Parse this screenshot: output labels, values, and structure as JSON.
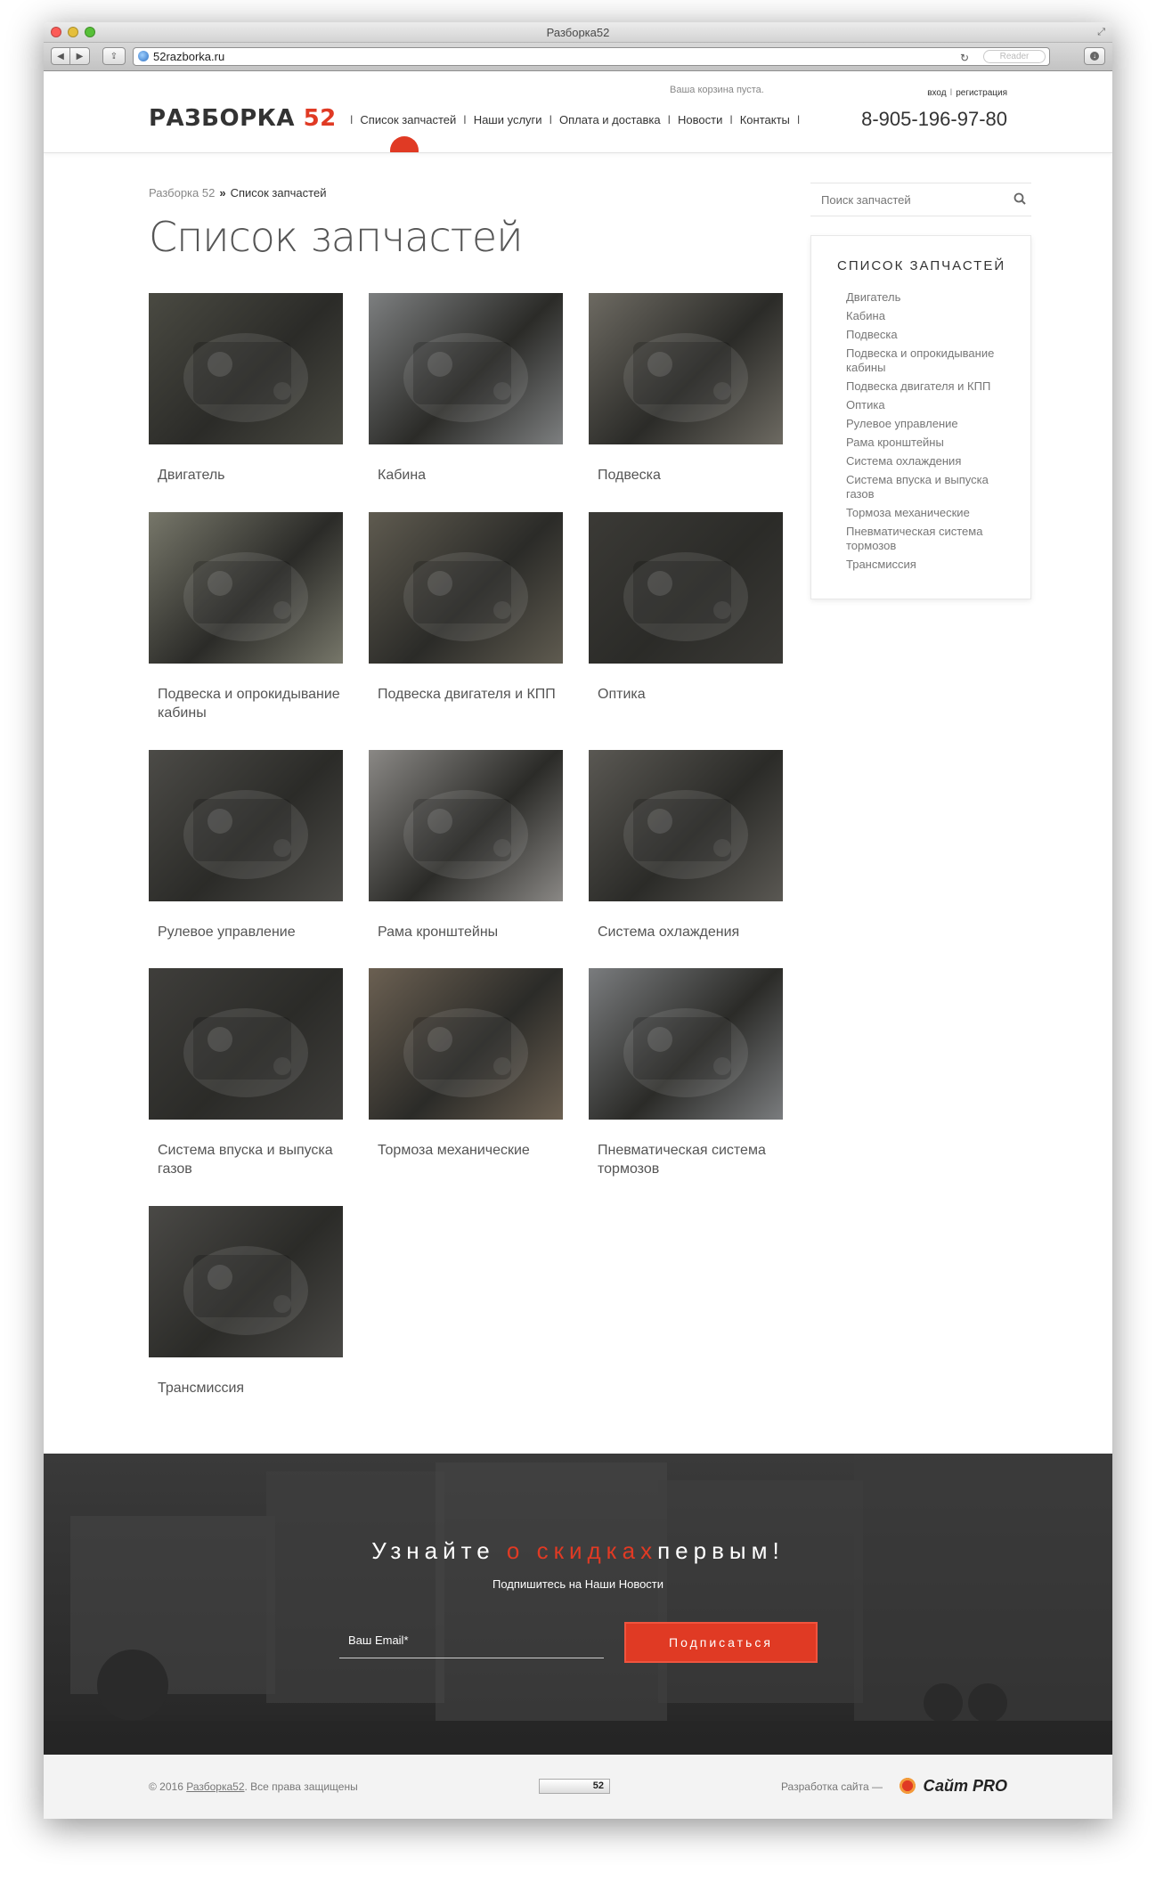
{
  "window": {
    "title": "Разборка52",
    "url": "52razborka.ru",
    "reader_label": "Reader"
  },
  "header": {
    "logo_text": "РАЗБОРКА",
    "logo_number": "52",
    "cart_status": "Ваша корзина пуста.",
    "login": "вход",
    "register": "регистрация",
    "phone": "8-905-196-97-80",
    "nav": [
      {
        "label": "Список запчастей"
      },
      {
        "label": "Наши услуги"
      },
      {
        "label": "Оплата и доставка"
      },
      {
        "label": "Новости"
      },
      {
        "label": "Контакты"
      }
    ]
  },
  "breadcrumb": {
    "home": "Разборка 52",
    "separator": "»",
    "current": "Список запчастей"
  },
  "page_title": "Список запчастей",
  "categories": [
    {
      "label": "Двигатель",
      "img_color": "#4a4a42"
    },
    {
      "label": "Кабина",
      "img_color": "#7d7f80"
    },
    {
      "label": "Подвеска",
      "img_color": "#6d6a62"
    },
    {
      "label": "Подвеска и опрокидывание кабины",
      "img_color": "#77776a"
    },
    {
      "label": "Подвеска двигателя и КПП",
      "img_color": "#5f5b50"
    },
    {
      "label": "Оптика",
      "img_color": "#3b3a36"
    },
    {
      "label": "Рулевое управление",
      "img_color": "#4c4b47"
    },
    {
      "label": "Рама кронштейны",
      "img_color": "#8a8885"
    },
    {
      "label": "Система охлаждения",
      "img_color": "#5a5853"
    },
    {
      "label": "Система впуска и выпуска газов",
      "img_color": "#3f3e3b"
    },
    {
      "label": "Тормоза механические",
      "img_color": "#6b6052"
    },
    {
      "label": "Пневматическая система тормозов",
      "img_color": "#7a7c7e"
    },
    {
      "label": "Трансмиссия",
      "img_color": "#4a4946"
    }
  ],
  "search": {
    "placeholder": "Поиск запчастей"
  },
  "sidebar": {
    "title": "Список запчастей",
    "items": [
      "Двигатель",
      "Кабина",
      "Подвеска",
      "Подвеска и опрокидывание кабины",
      "Подвеска двигателя и КПП",
      "Оптика",
      "Рулевое управление",
      "Рама кронштейны",
      "Система охлаждения",
      "Система впуска и выпуска газов",
      "Тормоза механические",
      "Пневматическая система тормозов",
      "Трансмиссия"
    ]
  },
  "subscribe": {
    "title_pre": "Узнайте ",
    "title_highlight": "о скидках",
    "title_post": "первым!",
    "subtitle": "Подпишитесь на Наши Новости",
    "email_placeholder": "Ваш Email*",
    "button": "Подписаться"
  },
  "footer": {
    "copyright_pre": "© 2016 ",
    "copyright_link": "Разборка52",
    "copyright_post": ". Все права защищены",
    "counter": "52",
    "dev_credit": "Разработка сайта —",
    "dev_logo": "Сайт PRO"
  },
  "colors": {
    "accent": "#e03a24",
    "dark_band": "#303030",
    "footer_bg": "#f3f3f3"
  }
}
